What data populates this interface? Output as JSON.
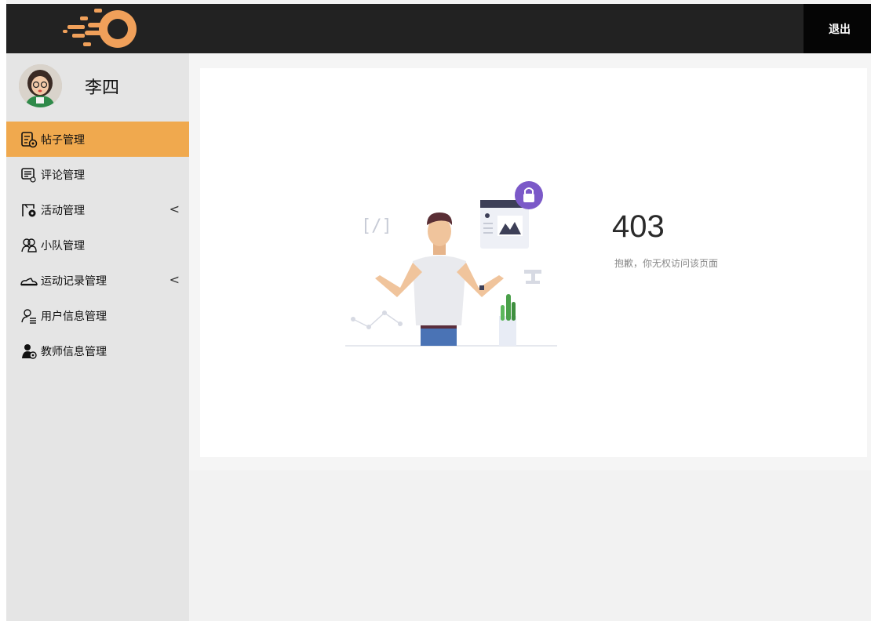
{
  "header": {
    "logout_label": "退出"
  },
  "user": {
    "name": "李四"
  },
  "sidebar": {
    "items": [
      {
        "label": "帖子管理",
        "icon": "post-manage-icon",
        "active": true
      },
      {
        "label": "评论管理",
        "icon": "comment-manage-icon"
      },
      {
        "label": "活动管理",
        "icon": "activity-manage-icon",
        "has_arrow": true
      },
      {
        "label": "小队管理",
        "icon": "team-icon"
      },
      {
        "label": "运动记录管理",
        "icon": "shoe-icon",
        "has_arrow": true
      },
      {
        "label": "用户信息管理",
        "icon": "user-info-icon"
      },
      {
        "label": "教师信息管理",
        "icon": "teacher-icon"
      }
    ],
    "expand_arrow": "<"
  },
  "error": {
    "code": "403",
    "message": "抱歉，你无权访问该页面"
  },
  "colors": {
    "topbar": "#222222",
    "active_menu": "#f0a94e",
    "logo_orange": "#f0a05a",
    "lock_purple": "#7b59c8"
  }
}
